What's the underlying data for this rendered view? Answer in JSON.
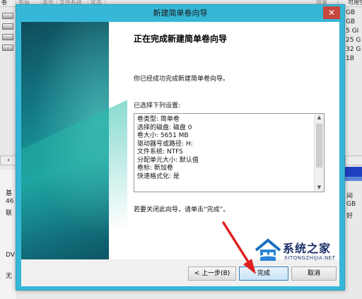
{
  "background": {
    "columns": [
      "卷",
      "布局",
      "类型",
      "文件系统",
      "状态",
      "容量",
      "可用空间"
    ],
    "right_values": [
      "GB",
      "GB",
      "5 GI",
      "25 G",
      "32 G",
      "1B"
    ],
    "left_texts": [
      "基",
      "46",
      "联",
      "DV",
      "无"
    ],
    "right_texts": [
      "间",
      "GB",
      "好"
    ]
  },
  "dialog": {
    "title": "新建简单卷向导",
    "close_glyph": "✕",
    "heading": "正在完成新建简单卷向导",
    "intro": "你已经成功完成新建简单卷向导。",
    "selected_label": "已选择下列设置:",
    "settings": [
      "卷类型: 简单卷",
      "选择的磁盘: 磁盘 0",
      "卷大小: 5651 MB",
      "驱动器号或路径: H:",
      "文件系统: NTFS",
      "分配单元大小: 默认值",
      "卷标: 新加卷",
      "快速格式化: 是"
    ],
    "finish_note": "若要关闭此向导，请单击“完成”。",
    "buttons": {
      "back": "< 上一步(B)",
      "finish": "完成",
      "cancel": "取消"
    }
  },
  "watermark": {
    "title": "系统之家",
    "subtitle": "XITONGZHIJIA.NET"
  },
  "colors": {
    "dialog_frame": "#36b7d7",
    "close_button": "#c7463d",
    "annotation_arrow": "#e02020"
  }
}
